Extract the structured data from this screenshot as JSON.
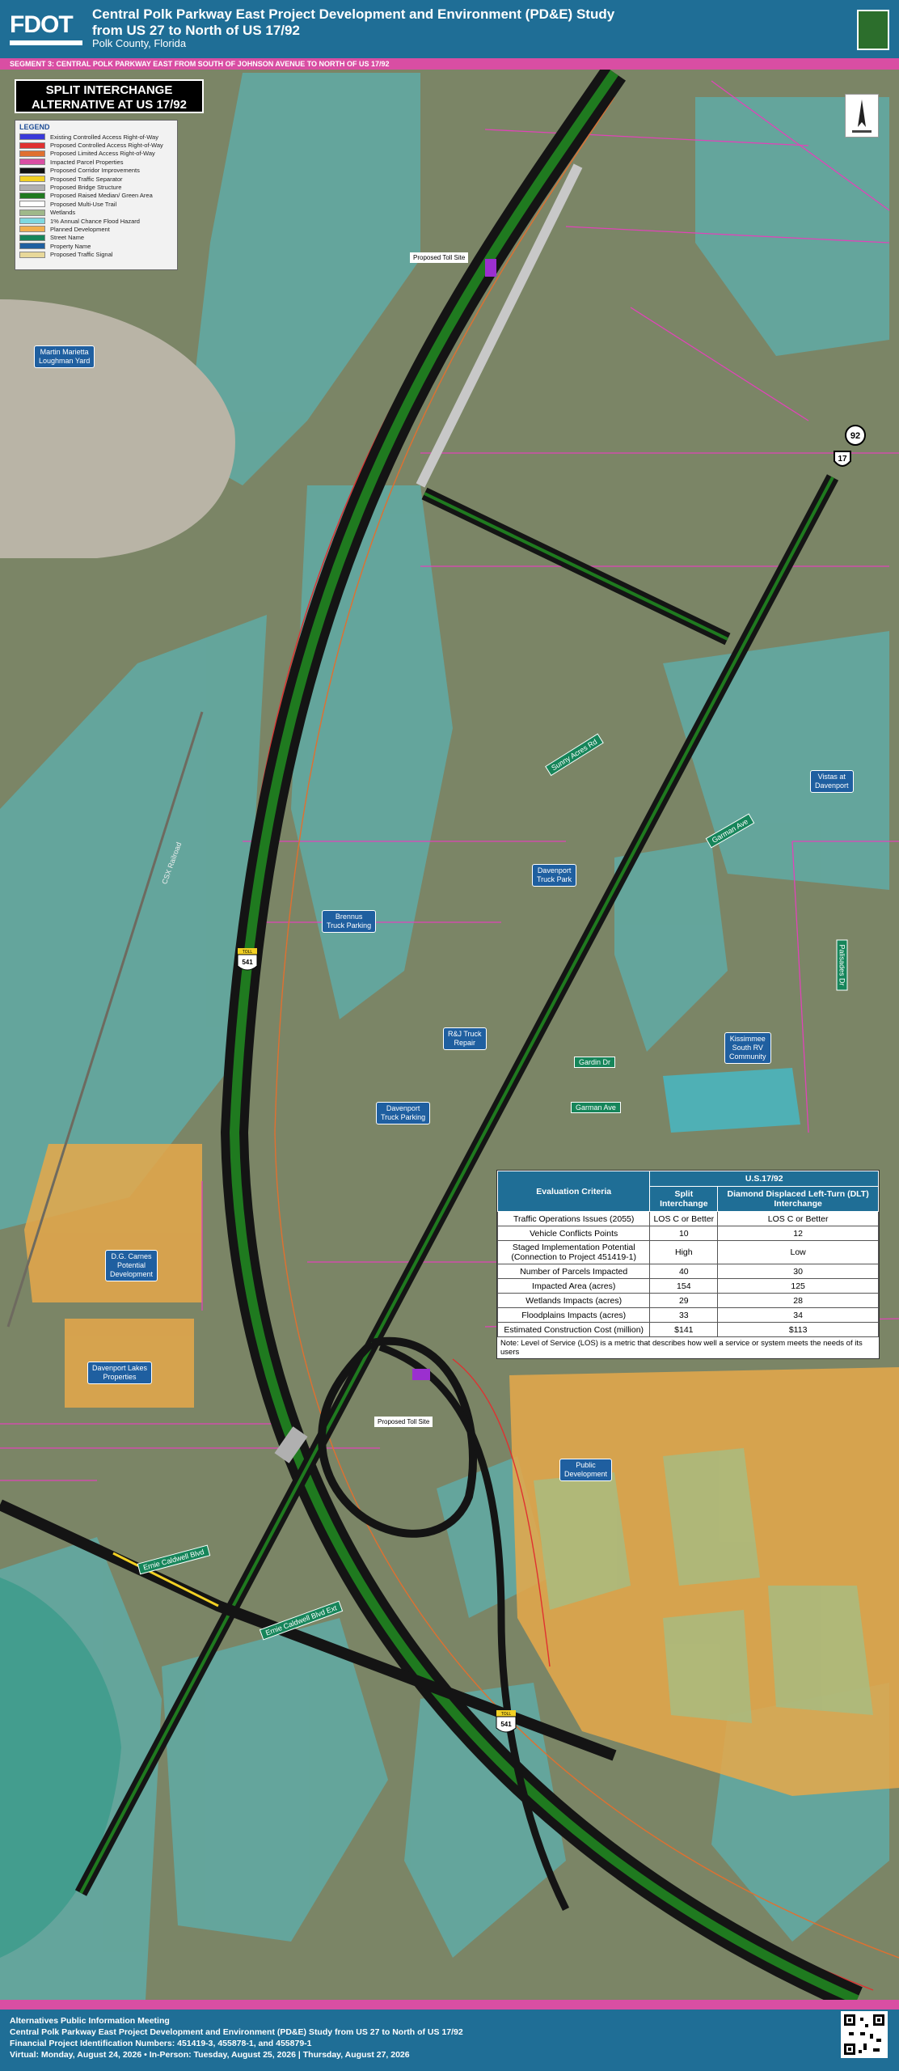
{
  "header": {
    "logo": "FDOT",
    "title_line1": "Central Polk Parkway East Project Development and Environment (PD&E) Study",
    "title_line2": "from US 27 to North of US 17/92",
    "subtitle": "Polk County, Florida",
    "seal_icon": "florida-dot-seal-icon"
  },
  "segment_bar": "SEGMENT 3: CENTRAL POLK PARKWAY EAST FROM SOUTH OF JOHNSON AVENUE TO NORTH OF US 17/92",
  "map_title_line1": "SPLIT INTERCHANGE",
  "map_title_line2": "ALTERNATIVE AT US 17/92",
  "legend": {
    "title": "LEGEND",
    "items": [
      {
        "label": "Existing Controlled Access Right-of-Way",
        "color": "#3a3ad9"
      },
      {
        "label": "Proposed Controlled Access Right-of-Way",
        "color": "#e03030"
      },
      {
        "label": "Proposed Limited Access Right-of-Way",
        "color": "#e07030"
      },
      {
        "label": "Impacted Parcel Properties",
        "color": "#d94ea3"
      },
      {
        "label": "Proposed Corridor Improvements",
        "color": "#111111"
      },
      {
        "label": "Proposed Traffic Separator",
        "color": "#f2d024"
      },
      {
        "label": "Proposed Bridge Structure",
        "color": "#b0b0b0"
      },
      {
        "label": "Proposed Raised Median/ Green Area",
        "color": "#1f7a1f"
      },
      {
        "label": "Proposed Multi-Use Trail",
        "color": "#ffffff"
      },
      {
        "label": "Wetlands",
        "color": "#9fb88a"
      },
      {
        "label": "1% Annual Chance Flood Hazard",
        "color": "#7fd8e0"
      },
      {
        "label": "Planned Development",
        "color": "#f0b050"
      },
      {
        "label": "Street Name",
        "color": "#16855a"
      },
      {
        "label": "Property Name",
        "color": "#1f5fa0"
      },
      {
        "label": "Proposed Traffic Signal",
        "color": "#e8d89a"
      }
    ]
  },
  "property_labels": {
    "martin": "Martin Marietta\nLoughman Yard",
    "vistas": "Vistas at\nDavenport",
    "dav_truck_park": "Davenport\nTruck Park",
    "brennus": "Brennus\nTruck Parking",
    "rj": "R&J Truck\nRepair",
    "kissimmee": "Kissimmee\nSouth RV\nCommunity",
    "dav_truck_parking": "Davenport\nTruck Parking",
    "dg_carnes": "D.G. Carnes\nPotential\nDevelopment",
    "dav_lakes": "Davenport Lakes\nProperties",
    "public_dev": "Public\nDevelopment"
  },
  "street_labels": {
    "sunny": "Sunny Acres Rd",
    "garman1": "Garman Ave",
    "garman2": "Garman Ave",
    "gardin": "Gardin Dr",
    "ernie1": "Ernie Caldwell Blvd",
    "ernie2": "Ernie Caldwell Blvd Ext",
    "palisades": "Palisades Dr",
    "sa": "CSX Railroad"
  },
  "toll_labels": {
    "north": "Proposed Toll Site",
    "south": "Proposed Toll Site"
  },
  "shields": {
    "toll_top": "TOLL",
    "num": "541",
    "us_a": "92",
    "us_b": "17"
  },
  "table": {
    "group_header": "U.S.17/92",
    "col_criteria": "Evaluation Criteria",
    "col_a": "Split Interchange",
    "col_b": "Diamond Displaced Left-Turn (DLT) Interchange",
    "rows": [
      [
        "Traffic Operations Issues (2055)",
        "LOS C or Better",
        "LOS C or Better"
      ],
      [
        "Vehicle Conflicts Points",
        "10",
        "12"
      ],
      [
        "Staged Implementation Potential (Connection to Project 451419-1)",
        "High",
        "Low"
      ],
      [
        "Number of Parcels Impacted",
        "40",
        "30"
      ],
      [
        "Impacted Area (acres)",
        "154",
        "125"
      ],
      [
        "Wetlands Impacts (acres)",
        "29",
        "28"
      ],
      [
        "Floodplains Impacts (acres)",
        "33",
        "34"
      ],
      [
        "Estimated Construction Cost (million)",
        "$141",
        "$113"
      ]
    ],
    "note": "Note: Level of Service (LOS) is a metric that describes how well a service or system meets the needs of its users"
  },
  "footer": {
    "line1": "Alternatives Public Information Meeting",
    "line2": "Central Polk Parkway East Project Development and Environment (PD&E) Study from US 27 to North of US 17/92",
    "line3": "Financial Project Identification Numbers: 451419-3, 455878-1, and 455879-1",
    "line4": "Virtual: Monday, August 24, 2026 • In-Person: Tuesday, August 25, 2026 | Thursday, August 27, 2026",
    "qr_icon": "qr-code-icon"
  }
}
